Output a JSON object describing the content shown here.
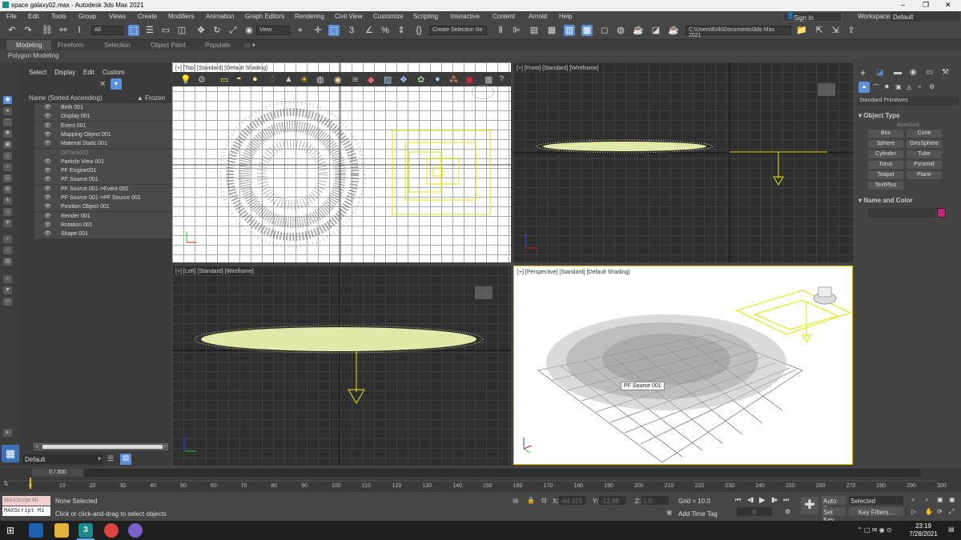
{
  "window": {
    "title": "space galaxy02.max - Autodesk 3ds Max 2021",
    "minimize": "–",
    "maximize": "❐",
    "close": "✕"
  },
  "menu": [
    "File",
    "Edit",
    "Tools",
    "Group",
    "Views",
    "Create",
    "Modifiers",
    "Animation",
    "Graph Editors",
    "Rendering",
    "Civil View",
    "Customize",
    "Scripting",
    "Interactive",
    "Content",
    "Arnold",
    "Help"
  ],
  "signin": "Sign In",
  "workspaces_label": "Workspaces:",
  "workspace": "Default",
  "toolbar": {
    "filter": "All",
    "view": "View",
    "selection_set": "Create Selection Se",
    "project_path": "C:\\Users\\Erik\\Documents\\3ds Max 2021"
  },
  "ribbon": {
    "tabs": [
      "Modeling",
      "Freeform",
      "Selection",
      "Object Paint",
      "Populate"
    ],
    "sub": "Polygon Modeling"
  },
  "scene_explorer": {
    "tabs": [
      "Select",
      "Display",
      "Edit",
      "Custom"
    ],
    "header_name": "Name (Sorted Ascending)",
    "header_frozen": "▲ Frozen",
    "items": [
      {
        "name": "Birth 001",
        "dim": false
      },
      {
        "name": "Display 001",
        "dim": false
      },
      {
        "name": "Event 001",
        "dim": false
      },
      {
        "name": "Mapping Object 001",
        "dim": false
      },
      {
        "name": "Material Static 001",
        "dim": false
      },
      {
        "name": "OilTank001",
        "dim": true
      },
      {
        "name": "Particle View 001",
        "dim": false
      },
      {
        "name": "PF Engine001",
        "dim": false
      },
      {
        "name": "PF Source 001",
        "dim": false
      },
      {
        "name": "PF Source 001->Event 001",
        "dim": false
      },
      {
        "name": "PF Source 001->PF Source 001",
        "dim": false
      },
      {
        "name": "Position Object 001",
        "dim": false
      },
      {
        "name": "Render 001",
        "dim": false
      },
      {
        "name": "Rotation 001",
        "dim": false
      },
      {
        "name": "Shape 001",
        "dim": false
      }
    ],
    "layer": "Default"
  },
  "viewports": {
    "top": "[+] [Top] [Standard] [Default Shading]",
    "front": "[+] [Front] [Standard] [Wireframe]",
    "left": "[+] [Left] [Standard] [Wireframe]",
    "perspective": "[+] [Perspective] [Standard] [Default Shading]",
    "tooltip": "PF Source 001"
  },
  "command_panel": {
    "category": "Standard Primitives",
    "object_type": "Object Type",
    "autogrid": "AutoGrid",
    "buttons": [
      "Box",
      "Cone",
      "Sphere",
      "GeoSphere",
      "Cylinder",
      "Tube",
      "Torus",
      "Pyramid",
      "Teapot",
      "Plane",
      "TextPlus"
    ],
    "name_and_color": "Name and Color",
    "color": "#d0207a"
  },
  "timeline": {
    "frame": "0 / 300",
    "ticks": [
      "0",
      "10",
      "20",
      "30",
      "40",
      "50",
      "60",
      "70",
      "80",
      "90",
      "100",
      "110",
      "120",
      "130",
      "140",
      "150",
      "160",
      "170",
      "180",
      "190",
      "200",
      "210",
      "220",
      "230",
      "240",
      "250",
      "260",
      "270",
      "280",
      "290",
      "300"
    ]
  },
  "status": {
    "maxscript": "MAXScript Mi",
    "selected": "None Selected",
    "prompt": "Click or click-and-drag to select objects",
    "x_label": "X:",
    "x": "-44.315",
    "y_label": "Y:",
    "y": "-12.38",
    "z_label": "Z:",
    "z": "0.0",
    "grid": "Grid = 10.0",
    "add_time_tag": "Add Time Tag",
    "auto_key": "Auto K...",
    "set_key": "Set Key",
    "selected_set": "Selected",
    "key_filters": "Key Filters...",
    "frame_field": "0"
  },
  "taskbar": {
    "time": "23:19",
    "date": "7/28/2021"
  }
}
